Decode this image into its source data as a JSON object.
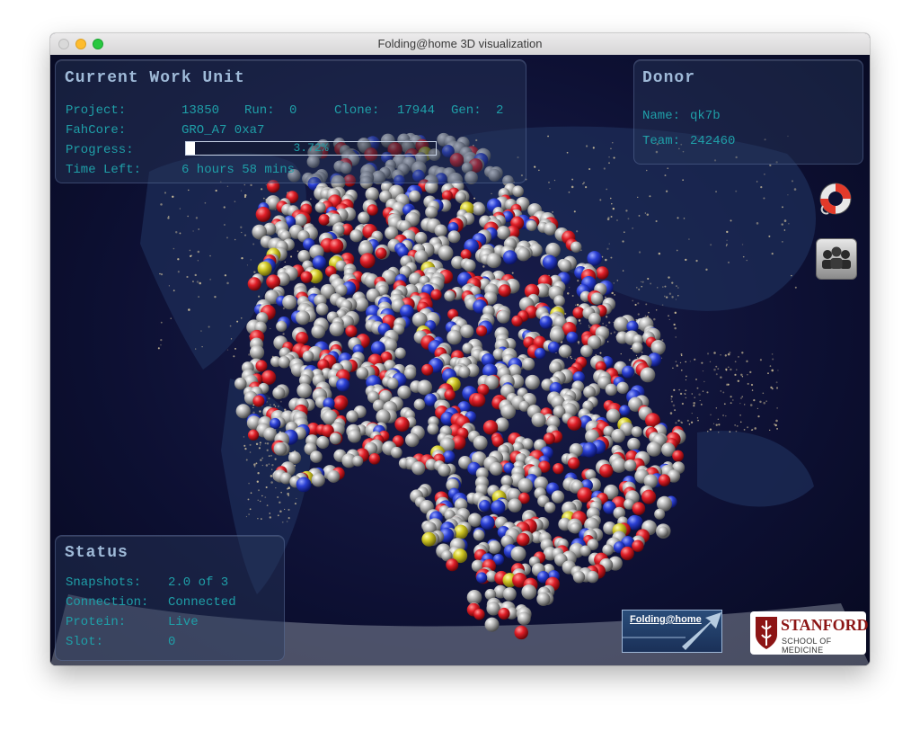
{
  "window": {
    "title": "Folding@home 3D visualization"
  },
  "work_unit": {
    "heading": "Current Work Unit",
    "project_label": "Project:",
    "project": "13850",
    "run_label": "Run:",
    "run": "0",
    "clone_label": "Clone:",
    "clone": "17944",
    "gen_label": "Gen:",
    "gen": "2",
    "fahcore_label": "FahCore:",
    "fahcore": "GRO_A7 0xa7",
    "progress_label": "Progress:",
    "progress_text": "3.72%",
    "progress_value": 0.0372,
    "time_left_label": "Time Left:",
    "time_left": "6 hours 58 mins"
  },
  "donor": {
    "heading": "Donor",
    "name_label": "Name:",
    "name": "qk7b",
    "team_label": "Team:",
    "team": "242460"
  },
  "status": {
    "heading": "Status",
    "snapshots_label": "Snapshots:",
    "snapshots": "2.0 of 3",
    "connection_label": "Connection:",
    "connection": "Connected",
    "protein_label": "Protein:",
    "protein": "Live",
    "slot_label": "Slot:",
    "slot": "0"
  },
  "icons": {
    "help": "lifebuoy-icon",
    "team": "people-icon"
  },
  "logos": {
    "fah": "Folding@home",
    "stanford_name": "STANFORD",
    "stanford_sub": "SCHOOL OF MEDICINE"
  },
  "colors": {
    "panel_text": "#1f9fa8",
    "heading": "#9fbad8",
    "atom_carbon": "#9a9a9a",
    "atom_oxygen": "#d8202a",
    "atom_nitrogen": "#2a3fd0",
    "atom_sulfur": "#c9c220"
  }
}
